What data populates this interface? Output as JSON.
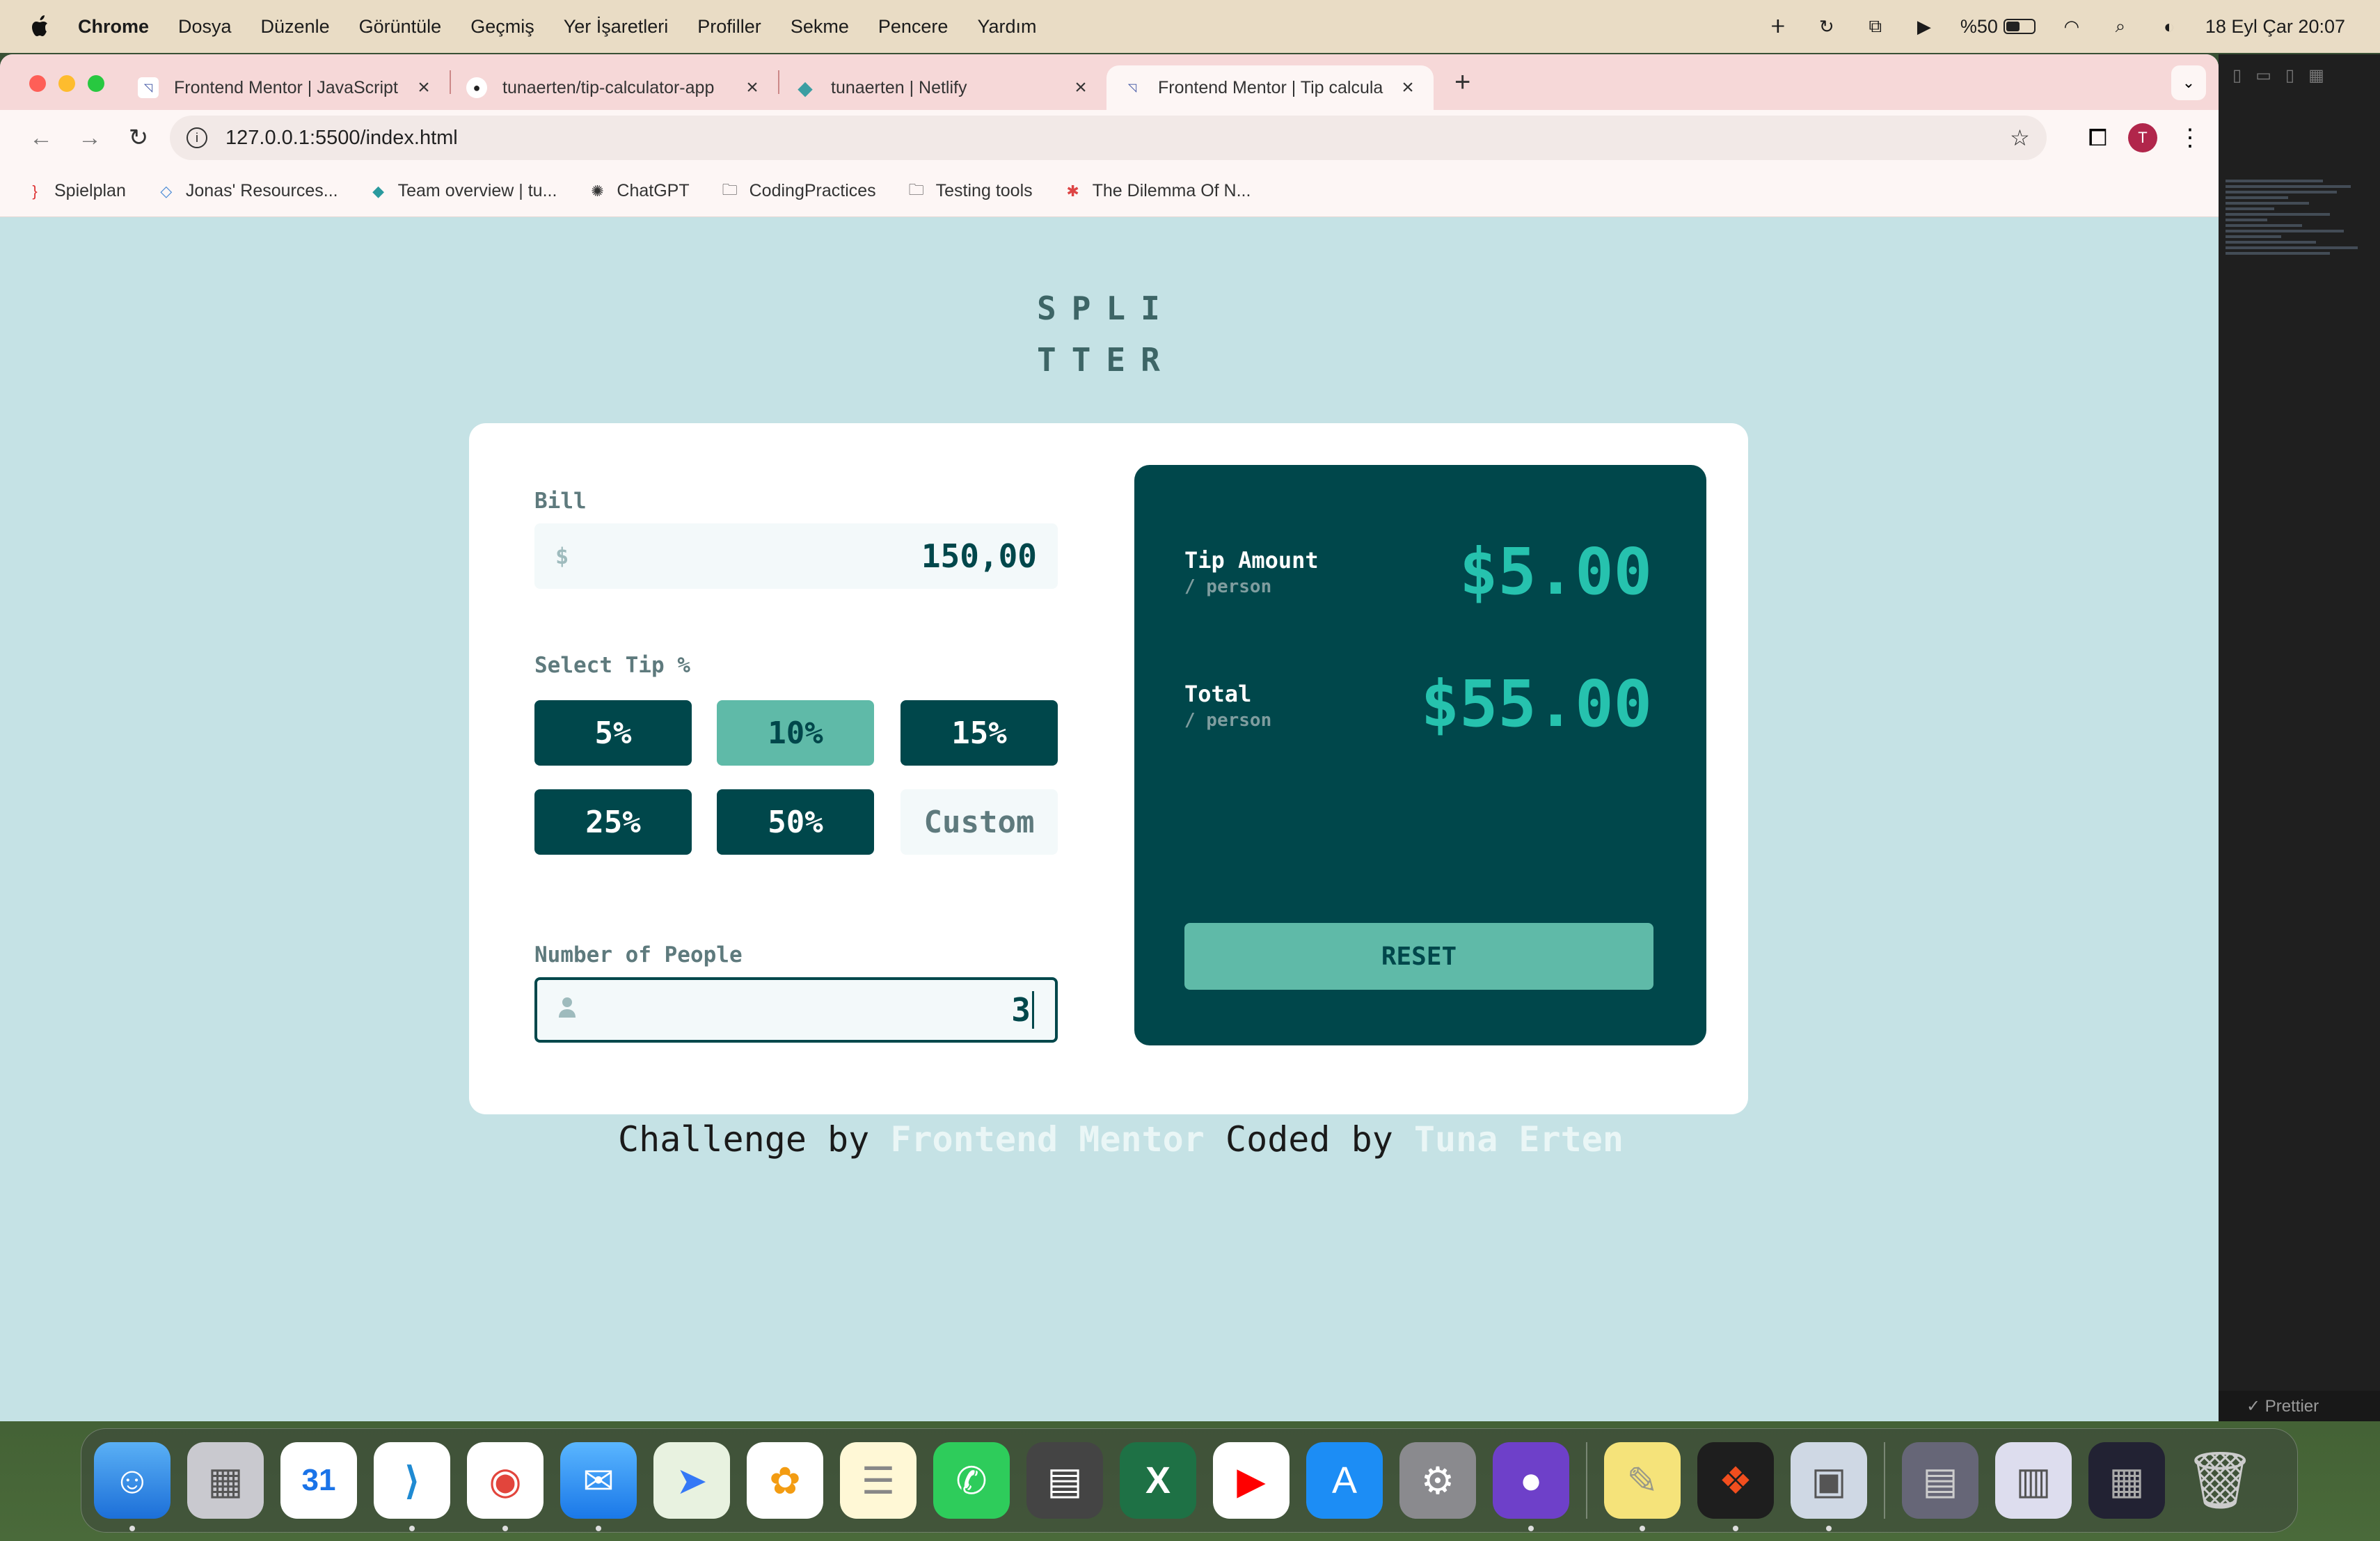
{
  "menubar": {
    "app": "Chrome",
    "items": [
      "Dosya",
      "Düzenle",
      "Görüntüle",
      "Geçmiş",
      "Yer İşaretleri",
      "Profiller",
      "Sekme",
      "Pencere",
      "Yardım"
    ],
    "battery": "%50",
    "battery_level": 0.5,
    "datetime": "18 Eyl Çar  20:07"
  },
  "tabs": [
    {
      "label": "Frontend Mentor | JavaScript",
      "icon": "frontend-mentor-icon"
    },
    {
      "label": "tunaerten/tip-calculator-app",
      "icon": "github-icon"
    },
    {
      "label": "tunaerten | Netlify",
      "icon": "netlify-icon"
    },
    {
      "label": "Frontend Mentor | Tip calcula",
      "icon": "frontend-mentor-icon",
      "active": true
    }
  ],
  "toolbar": {
    "url": "127.0.0.1:5500/index.html",
    "profile_initial": "T"
  },
  "bookmarks": [
    {
      "label": "Spielplan",
      "icon": "bracket-icon"
    },
    {
      "label": "Jonas' Resources...",
      "icon": "diamond-icon"
    },
    {
      "label": "Team overview | tu...",
      "icon": "netlify-icon"
    },
    {
      "label": "ChatGPT",
      "icon": "chatgpt-icon"
    },
    {
      "label": "CodingPractices",
      "icon": "folder-icon"
    },
    {
      "label": "Testing tools",
      "icon": "folder-icon"
    },
    {
      "label": "The Dilemma Of N...",
      "icon": "asterisk-icon"
    }
  ],
  "app": {
    "logo_line1": "SPLI",
    "logo_line2": "TTER",
    "bill_label": "Bill",
    "bill_prefix": "$",
    "bill_value": "150,00",
    "select_tip_label": "Select Tip %",
    "tips": [
      "5%",
      "10%",
      "15%",
      "25%",
      "50%"
    ],
    "selected_tip": "10%",
    "custom_placeholder": "Custom",
    "people_label": "Number of People",
    "people_value": "3",
    "tip_amount_label": "Tip Amount",
    "tip_amount_sub": "/ person",
    "tip_amount_value": "$5.00",
    "total_label": "Total",
    "total_sub": "/ person",
    "total_value": "$55.00",
    "reset_label": "RESET"
  },
  "footer": {
    "prefix": "Challenge by ",
    "link1": "Frontend Mentor",
    "middle": " Coded by ",
    "link2": "Tuna Erten"
  },
  "editor": {
    "status": "✓ Prettier"
  },
  "dock": [
    "Finder",
    "Launchpad",
    "Calendar",
    "VS Code",
    "Chrome",
    "Mail",
    "Maps",
    "Photos",
    "Notes",
    "WhatsApp",
    "Calculator",
    "Excel",
    "YouTube Music",
    "App Store",
    "System Settings",
    "GitHub Desktop",
    "Stickies",
    "Figma",
    "Preview",
    "Trash"
  ],
  "dock_calendar_day": "31"
}
